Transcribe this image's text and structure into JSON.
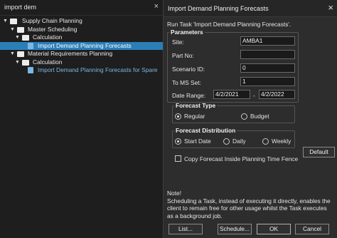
{
  "search": {
    "text": "import dem",
    "close_glyph": "×"
  },
  "tree": [
    {
      "label": "Supply Chain Planning",
      "level": 0,
      "expanded": true,
      "icon": "folder-icon"
    },
    {
      "label": "Master Scheduling",
      "level": 1,
      "expanded": true,
      "icon": "folder-icon"
    },
    {
      "label": "Calculation",
      "level": 2,
      "expanded": true,
      "icon": "folder-icon"
    },
    {
      "label": "Import Demand Planning Forecasts",
      "level": 3,
      "selected": true,
      "icon": "task-icon"
    },
    {
      "label": "Material Requirements Planning",
      "level": 1,
      "expanded": true,
      "icon": "folder-icon"
    },
    {
      "label": "Calculation",
      "level": 2,
      "expanded": true,
      "icon": "folder-icon"
    },
    {
      "label": "Import Demand Planning Forecasts for Spare",
      "level": 3,
      "selected": false,
      "icon": "task-icon"
    }
  ],
  "dialog": {
    "title": "Import Demand Planning Forecasts",
    "close_glyph": "×",
    "run_text": "Run Task 'Import Demand Planning Forecasts'.",
    "params": {
      "legend": "Parameters",
      "site_label": "Site:",
      "site_value": "AMBA1",
      "part_label": "Part No:",
      "part_value": "",
      "scenario_label": "Scenario ID:",
      "scenario_value": "0",
      "toms_label": "To MS Set:",
      "toms_value": "1",
      "date_label": "Date Range:",
      "date_from": "4/2/2021",
      "date_sep": "-",
      "date_to": "4/2/2022"
    },
    "forecast_type": {
      "legend": "Forecast Type",
      "options": [
        "Regular",
        "Budget"
      ],
      "selected": "Regular"
    },
    "forecast_distribution": {
      "legend": "Forecast Distribution",
      "options": [
        "Start Date",
        "Daily",
        "Weekly"
      ],
      "selected": "Start Date"
    },
    "copy_forecast_label": "Copy Forecast Inside Planning Time Fence",
    "copy_forecast_checked": false,
    "default_button": "Default",
    "note_title": "Note!",
    "note_text": "Scheduling a Task, instead of executing it directly, enables the client  to remain free for other usage whilst the Task executes as a background job.",
    "buttons": {
      "list": "List...",
      "schedule": "Schedule...",
      "ok": "OK",
      "cancel": "Cancel"
    }
  }
}
